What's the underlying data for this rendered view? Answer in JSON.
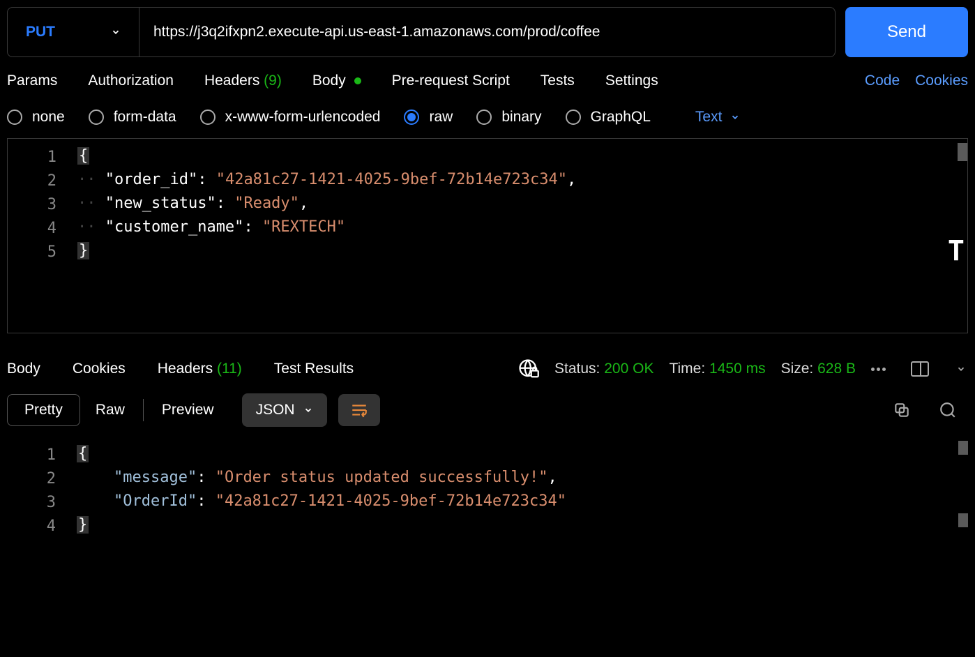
{
  "request": {
    "method": "PUT",
    "url": "https://j3q2ifxpn2.execute-api.us-east-1.amazonaws.com/prod/coffee",
    "send_label": "Send"
  },
  "request_tabs": {
    "params": "Params",
    "authorization": "Authorization",
    "headers": "Headers",
    "headers_count": "(9)",
    "body": "Body",
    "prerequest": "Pre-request Script",
    "tests": "Tests",
    "settings": "Settings",
    "code": "Code",
    "cookies": "Cookies"
  },
  "body_types": {
    "none": "none",
    "formdata": "form-data",
    "urlencoded": "x-www-form-urlencoded",
    "raw": "raw",
    "binary": "binary",
    "graphql": "GraphQL",
    "format": "Text"
  },
  "request_body": {
    "line1": "{",
    "line2_key": "\"order_id\"",
    "line2_val": "\"42a81c27-1421-4025-9bef-72b14e723c34\"",
    "line3_key": "\"new_status\"",
    "line3_val": "\"Ready\"",
    "line4_key": "\"customer_name\"",
    "line4_val": "\"REXTECH\"",
    "line5": "}"
  },
  "response_tabs": {
    "body": "Body",
    "cookies": "Cookies",
    "headers": "Headers",
    "headers_count": "(11)",
    "test_results": "Test Results"
  },
  "response_status": {
    "status_label": "Status:",
    "status_value": "200 OK",
    "time_label": "Time:",
    "time_value": "1450 ms",
    "size_label": "Size:",
    "size_value": "628 B"
  },
  "view_toolbar": {
    "pretty": "Pretty",
    "raw": "Raw",
    "preview": "Preview",
    "json": "JSON"
  },
  "response_body": {
    "line1": "{",
    "line2_key": "\"message\"",
    "line2_val": "\"Order status updated successfully!\"",
    "line3_key": "\"OrderId\"",
    "line3_val": "\"42a81c27-1421-4025-9bef-72b14e723c34\"",
    "line4": "}"
  }
}
